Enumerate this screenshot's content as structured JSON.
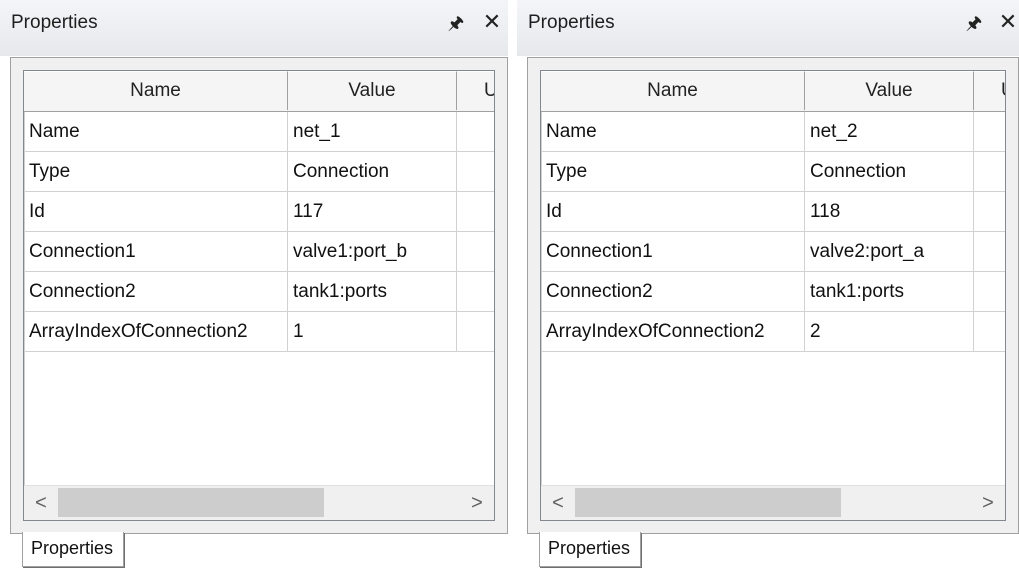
{
  "panels": [
    {
      "title": "Properties",
      "pin_icon": "pin-icon",
      "close_icon": "close-icon",
      "columns": [
        "Name",
        "Value",
        "U"
      ],
      "rows": [
        {
          "name": "Name",
          "value": "net_1"
        },
        {
          "name": "Type",
          "value": "Connection"
        },
        {
          "name": "Id",
          "value": "117"
        },
        {
          "name": "Connection1",
          "value": "valve1:port_b"
        },
        {
          "name": "Connection2",
          "value": "tank1:ports"
        },
        {
          "name": "ArrayIndexOfConnection2",
          "value": "1"
        }
      ],
      "scroll_left": "<",
      "scroll_right": ">",
      "tab_label": "Properties"
    },
    {
      "title": "Properties",
      "pin_icon": "pin-icon",
      "close_icon": "close-icon",
      "columns": [
        "Name",
        "Value",
        "U"
      ],
      "rows": [
        {
          "name": "Name",
          "value": "net_2"
        },
        {
          "name": "Type",
          "value": "Connection"
        },
        {
          "name": "Id",
          "value": "118"
        },
        {
          "name": "Connection1",
          "value": "valve2:port_a"
        },
        {
          "name": "Connection2",
          "value": "tank1:ports"
        },
        {
          "name": "ArrayIndexOfConnection2",
          "value": "2"
        }
      ],
      "scroll_left": "<",
      "scroll_right": ">",
      "tab_label": "Properties"
    }
  ],
  "colors": {
    "titlebar": "#e9ebef",
    "frame": "#f0f0f0",
    "grid_line": "#d2d2d2",
    "scroll_thumb": "#cdcdcd"
  }
}
